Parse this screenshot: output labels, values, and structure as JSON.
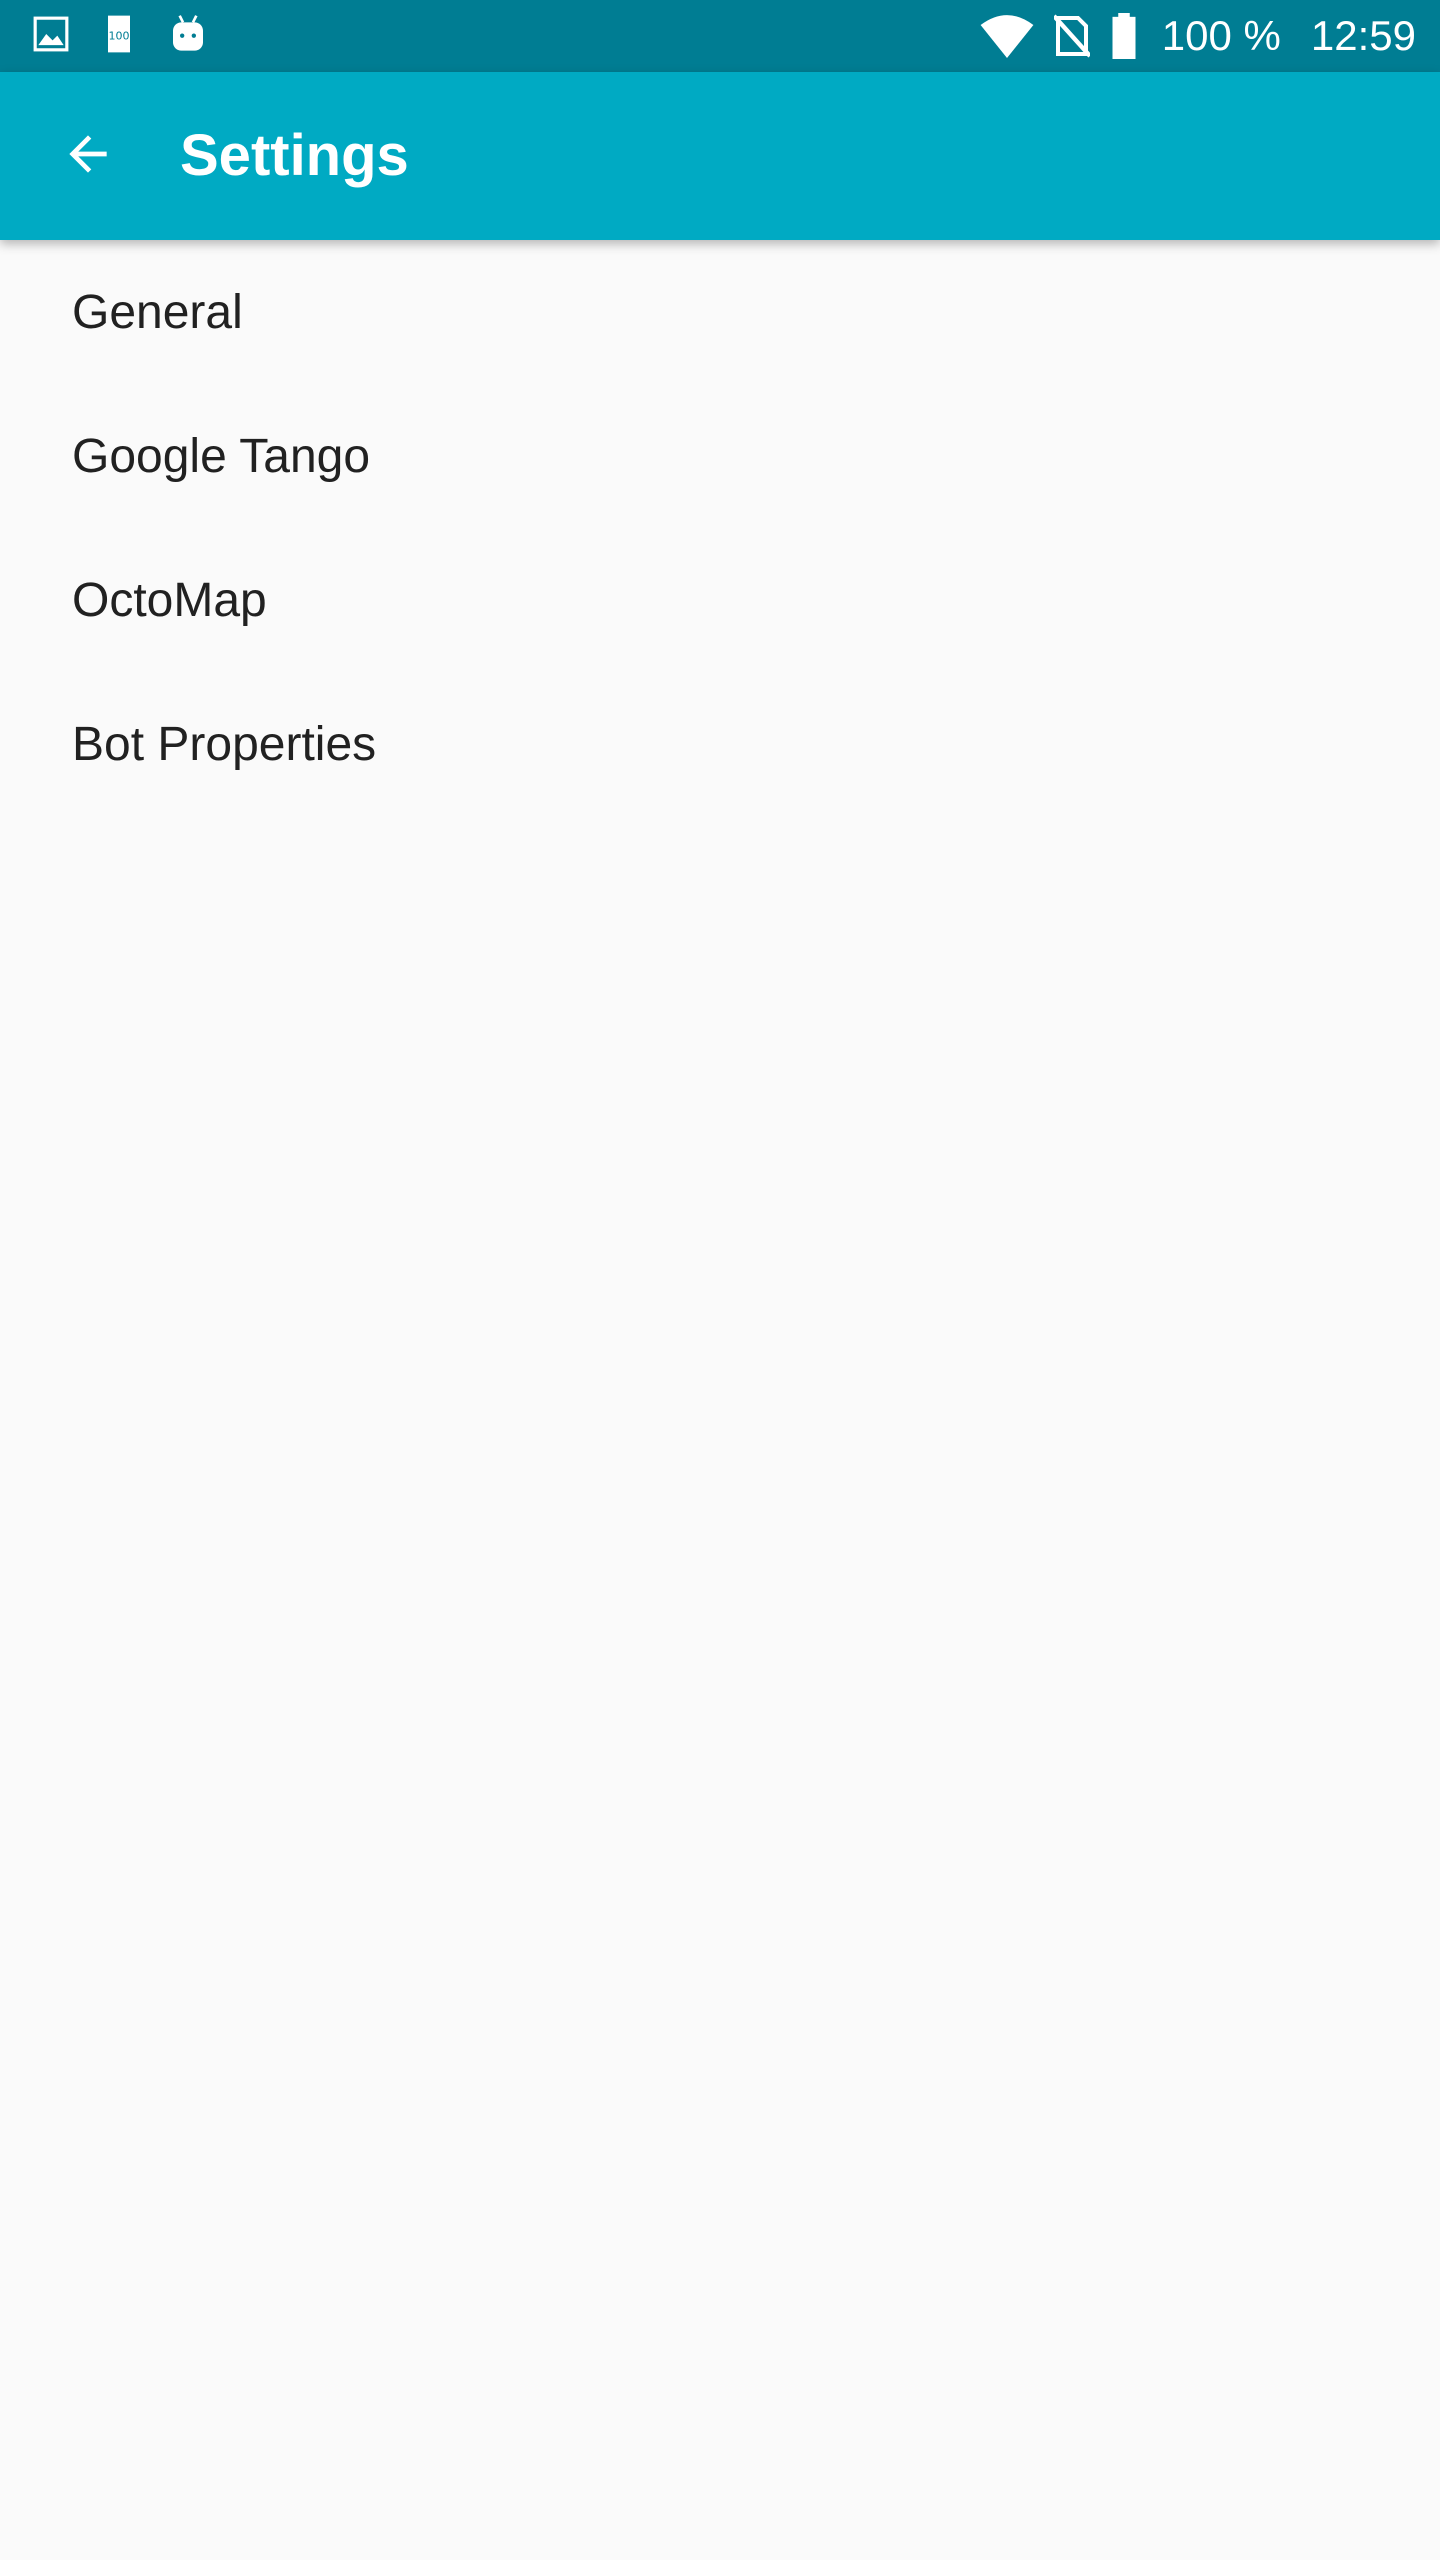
{
  "status_bar": {
    "left_icons": [
      "image-icon",
      "sd-card-icon",
      "android-icon"
    ],
    "right_icons": [
      "wifi-icon",
      "no-sim-icon",
      "battery-icon"
    ],
    "battery_percent": "100 %",
    "time": "12:59"
  },
  "app_bar": {
    "back_icon": "arrow-back-icon",
    "title": "Settings",
    "color": "#00aac3",
    "status_color": "#007d93"
  },
  "settings": {
    "items": [
      {
        "label": "General"
      },
      {
        "label": "Google Tango"
      },
      {
        "label": "OctoMap"
      },
      {
        "label": "Bot Properties"
      }
    ]
  }
}
